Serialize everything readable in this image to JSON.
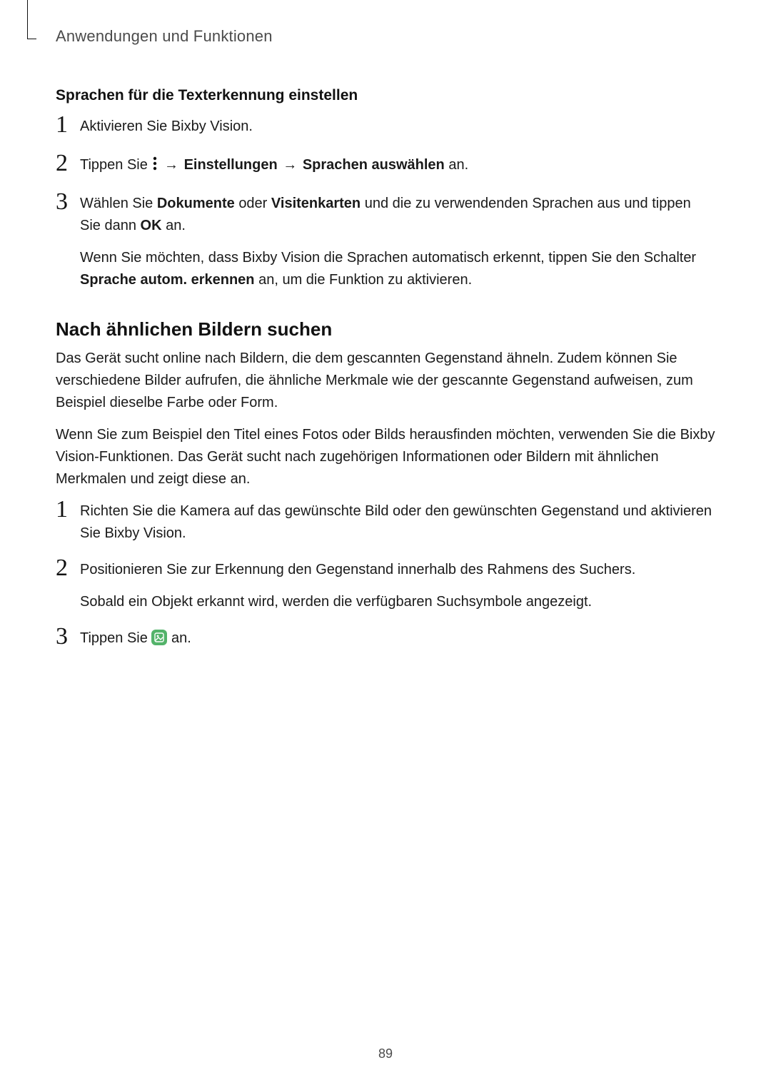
{
  "runningHead": "Anwendungen und Funktionen",
  "section1": {
    "title": "Sprachen für die Texterkennung einstellen",
    "steps": [
      {
        "text": "Aktivieren Sie Bixby Vision."
      },
      {
        "prefix": "Tippen Sie ",
        "arrow1": " → ",
        "bold1": "Einstellungen",
        "arrow2": " → ",
        "bold2": "Sprachen auswählen",
        "suffix": " an."
      },
      {
        "p1_a": "Wählen Sie ",
        "p1_b1": "Dokumente",
        "p1_c": " oder ",
        "p1_b2": "Visitenkarten",
        "p1_d": " und die zu verwendenden Sprachen aus und tippen Sie dann ",
        "p1_b3": "OK",
        "p1_e": " an.",
        "p2_a": "Wenn Sie möchten, dass Bixby Vision die Sprachen automatisch erkennt, tippen Sie den Schalter ",
        "p2_b": "Sprache autom. erkennen",
        "p2_c": " an, um die Funktion zu aktivieren."
      }
    ]
  },
  "section2": {
    "title": "Nach ähnlichen Bildern suchen",
    "para1": "Das Gerät sucht online nach Bildern, die dem gescannten Gegenstand ähneln. Zudem können Sie verschiedene Bilder aufrufen, die ähnliche Merkmale wie der gescannte Gegenstand aufweisen, zum Beispiel dieselbe Farbe oder Form.",
    "para2": "Wenn Sie zum Beispiel den Titel eines Fotos oder Bilds herausfinden möchten, verwenden Sie die Bixby Vision-Funktionen. Das Gerät sucht nach zugehörigen Informationen oder Bildern mit ähnlichen Merkmalen und zeigt diese an.",
    "steps": [
      {
        "text": "Richten Sie die Kamera auf das gewünschte Bild oder den gewünschten Gegenstand und aktivieren Sie Bixby Vision."
      },
      {
        "p1": "Positionieren Sie zur Erkennung den Gegenstand innerhalb des Rahmens des Suchers.",
        "p2": "Sobald ein Objekt erkannt wird, werden die verfügbaren Suchsymbole angezeigt."
      },
      {
        "prefix": "Tippen Sie ",
        "suffix": " an."
      }
    ]
  },
  "pageNumber": "89",
  "icons": {
    "moreVert": "more-options-icon",
    "imageBadge": "image-search-icon"
  }
}
